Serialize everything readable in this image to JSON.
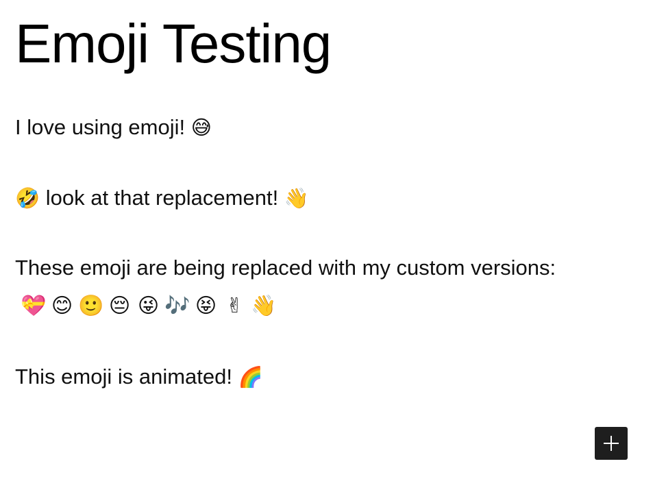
{
  "page": {
    "title": "Emoji Testing"
  },
  "paragraphs": {
    "love": {
      "text": "I love using emoji! ",
      "emoji": "😅"
    },
    "replacement": {
      "emoji_before": "🤣",
      "text": " look at that replacement! ",
      "emoji_after": "👋"
    },
    "custom": {
      "text": "These emoji are being replaced with my custom versions:"
    },
    "animated": {
      "text": "This emoji is animated! ",
      "emoji": "🌈"
    }
  },
  "custom_emoji": [
    "💝",
    "😊",
    "🙂",
    "😔",
    "😜",
    "🎶",
    "😝",
    "✌",
    "👋"
  ],
  "add_block_button": {
    "icon": "plus-icon",
    "color": "#1e1e1e"
  }
}
